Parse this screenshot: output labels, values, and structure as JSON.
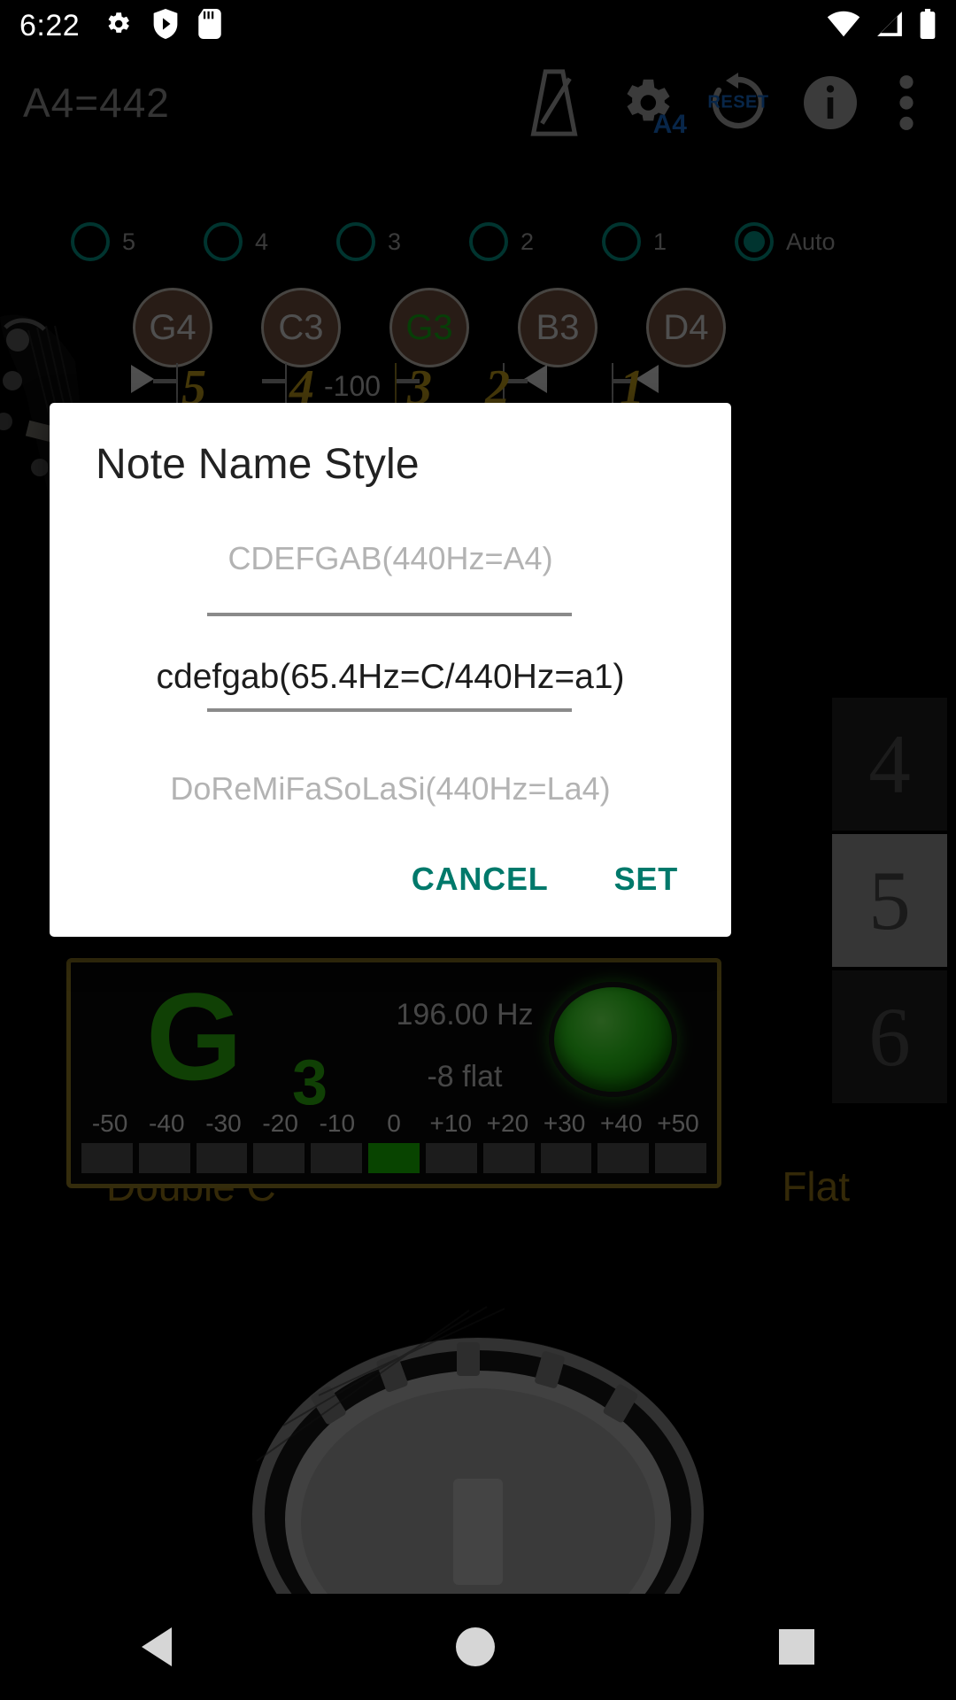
{
  "status_bar": {
    "time": "6:22",
    "left_icons": [
      "settings-gear-icon",
      "shield-play-icon",
      "sd-card-icon"
    ],
    "right_icons": [
      "wifi-icon",
      "cellular-signal-icon",
      "battery-icon"
    ]
  },
  "app_bar": {
    "title": "A4=442",
    "actions": [
      {
        "name": "metronome-icon",
        "label": "Metronome"
      },
      {
        "name": "gear-a4-icon",
        "label": "A4"
      },
      {
        "name": "reset-icon",
        "label": "RESET"
      },
      {
        "name": "info-icon",
        "label": "Info"
      },
      {
        "name": "overflow-menu-icon",
        "label": "More options"
      }
    ]
  },
  "string_count_radios": {
    "options": [
      "5",
      "4",
      "3",
      "2",
      "1",
      "Auto"
    ],
    "selected": "Auto"
  },
  "string_buttons": {
    "notes": [
      "G4",
      "C3",
      "G3",
      "B3",
      "D4"
    ],
    "active": "G3"
  },
  "scale": {
    "numbers": [
      "5",
      "4",
      "3",
      "2",
      "1"
    ],
    "left_limit": "-100"
  },
  "presets": {
    "left": "Double C",
    "right": "Flat"
  },
  "tuner": {
    "note": "G",
    "octave": "3",
    "frequency": "196.00 Hz",
    "deviation": "-8 flat",
    "led": "green",
    "cent_labels": [
      "-50",
      "-40",
      "-30",
      "-20",
      "-10",
      "0",
      "+10",
      "+20",
      "+30",
      "+40",
      "+50"
    ],
    "lit_index": 5
  },
  "dialog": {
    "title": "Note Name Style",
    "options": {
      "previous": "CDEFGAB(440Hz=A4)",
      "selected": "cdefgab(65.4Hz=C/440Hz=a1)",
      "next": "DoReMiFaSoLaSi(440Hz=La4)"
    },
    "cancel_label": "CANCEL",
    "set_label": "SET"
  },
  "nav_bar": {
    "back": "back-icon",
    "home": "home-icon",
    "recents": "recents-icon"
  },
  "colors": {
    "accent_teal": "#00796b",
    "radio_teal": "#00897b",
    "tuner_green": "#2aa80e",
    "gold": "#8a7420"
  }
}
